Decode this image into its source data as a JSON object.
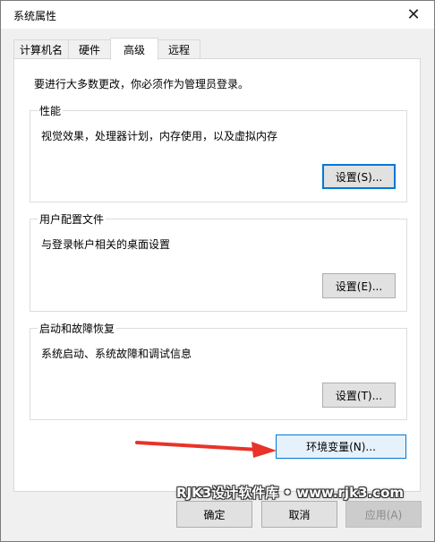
{
  "window": {
    "title": "系统属性",
    "close_symbol": "✕"
  },
  "tabs": [
    {
      "label": "计算机名",
      "active": false
    },
    {
      "label": "硬件",
      "active": false
    },
    {
      "label": "高级",
      "active": true
    },
    {
      "label": "远程",
      "active": false
    }
  ],
  "notice": "要进行大多数更改，你必须作为管理员登录。",
  "groups": {
    "performance": {
      "title": "性能",
      "description": "视觉效果，处理器计划，内存使用，以及虚拟内存",
      "button": "设置(S)..."
    },
    "user_profiles": {
      "title": "用户配置文件",
      "description": "与登录帐户相关的桌面设置",
      "button": "设置(E)..."
    },
    "startup_recovery": {
      "title": "启动和故障恢复",
      "description": "系统启动、系统故障和调试信息",
      "button": "设置(T)..."
    }
  },
  "env_button": "环境变量(N)...",
  "footer": {
    "ok": "确定",
    "cancel": "取消",
    "apply": "应用(A)"
  },
  "watermark": "RJK3设计软件库 • www.rjk3.com",
  "colors": {
    "accent": "#0078d7",
    "arrow": "#e8332a"
  }
}
